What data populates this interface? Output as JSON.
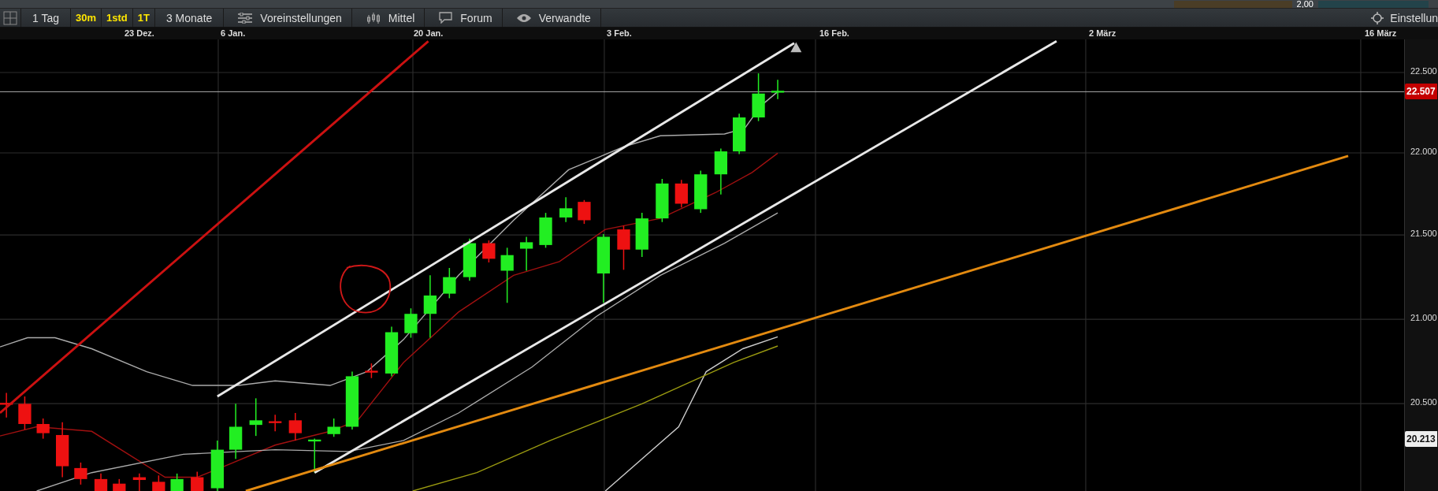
{
  "top_strip": {
    "value": "2,00"
  },
  "toolbar": {
    "items": [
      {
        "kind": "plain",
        "label": "1 Tag"
      },
      {
        "kind": "interval",
        "label": "30m"
      },
      {
        "kind": "interval",
        "label": "1std"
      },
      {
        "kind": "interval",
        "label": "1T"
      },
      {
        "kind": "plain",
        "label": "3 Monate"
      },
      {
        "kind": "icon",
        "label": "Voreinstellungen"
      },
      {
        "kind": "icon",
        "label": "Mittel"
      },
      {
        "kind": "icon",
        "label": "Forum"
      },
      {
        "kind": "icon",
        "label": "Verwandte"
      }
    ],
    "settings": "Einstellun"
  },
  "chart": {
    "x_labels": [
      "23 Dez.",
      "6 Jan.",
      "20 Jan.",
      "3 Feb.",
      "16 Feb.",
      "2 März",
      "16 März"
    ],
    "y_labels": [
      "22.500",
      "22.000",
      "21.500",
      "21.000",
      "20.500"
    ],
    "last_price": "22.507",
    "marker_price": "20.213"
  }
}
